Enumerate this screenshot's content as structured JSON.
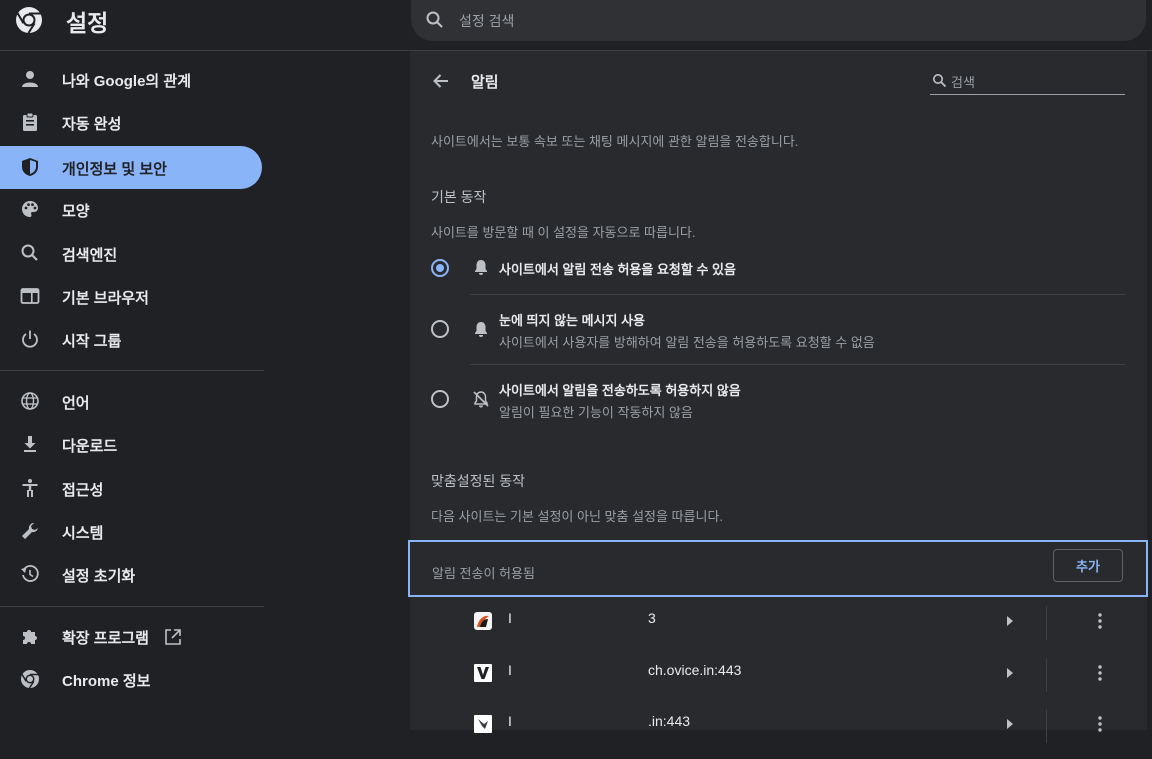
{
  "header": {
    "app_title": "설정",
    "search_placeholder": "설정 검색"
  },
  "sidebar": {
    "items": [
      {
        "label": "나와 Google의 관계",
        "icon": "person-icon"
      },
      {
        "label": "자동 완성",
        "icon": "clipboard-icon"
      },
      {
        "label": "개인정보 및 보안",
        "icon": "shield-icon",
        "active": true
      },
      {
        "label": "모양",
        "icon": "palette-icon"
      },
      {
        "label": "검색엔진",
        "icon": "search-icon"
      },
      {
        "label": "기본 브라우저",
        "icon": "browser-icon"
      },
      {
        "label": "시작 그룹",
        "icon": "power-icon"
      },
      {
        "label": "언어",
        "icon": "globe-icon"
      },
      {
        "label": "다운로드",
        "icon": "download-icon"
      },
      {
        "label": "접근성",
        "icon": "accessibility-icon"
      },
      {
        "label": "시스템",
        "icon": "wrench-icon"
      },
      {
        "label": "설정 초기화",
        "icon": "history-icon"
      },
      {
        "label": "확장 프로그램",
        "icon": "puzzle-icon"
      },
      {
        "label": "Chrome 정보",
        "icon": "chrome-icon"
      }
    ]
  },
  "main": {
    "title": "알림",
    "search_placeholder": "검색",
    "intro": "사이트에서는 보통 속보 또는 채팅 메시지에 관한 알림을 전송합니다.",
    "default_behavior": {
      "heading": "기본 동작",
      "description": "사이트를 방문할 때 이 설정을 자동으로 따릅니다.",
      "options": [
        {
          "title": "사이트에서 알림 전송 허용을 요청할 수 있음",
          "desc": "",
          "selected": true,
          "icon": "bell-icon"
        },
        {
          "title": "눈에 띄지 않는 메시지 사용",
          "desc": "사이트에서 사용자를 방해하여 알림 전송을 허용하도록 요청할 수 없음",
          "selected": false,
          "icon": "bell-icon"
        },
        {
          "title": "사이트에서 알림을 전송하도록 허용하지 않음",
          "desc": "알림이 필요한 기능이 작동하지 않음",
          "selected": false,
          "icon": "bell-off-icon"
        }
      ]
    },
    "custom_behavior": {
      "heading": "맞춤설정된 동작",
      "description": "다음 사이트는 기본 설정이 아닌 맞춤 설정을 따릅니다."
    },
    "allowed": {
      "label": "알림 전송이 허용됨",
      "add_label": "추가",
      "sites": [
        {
          "text_start": "I",
          "text_end": "3"
        },
        {
          "text_start": "I",
          "text_end": "ch.ovice.in:443"
        },
        {
          "text_start": "I",
          "text_end": ".in:443"
        }
      ]
    }
  }
}
